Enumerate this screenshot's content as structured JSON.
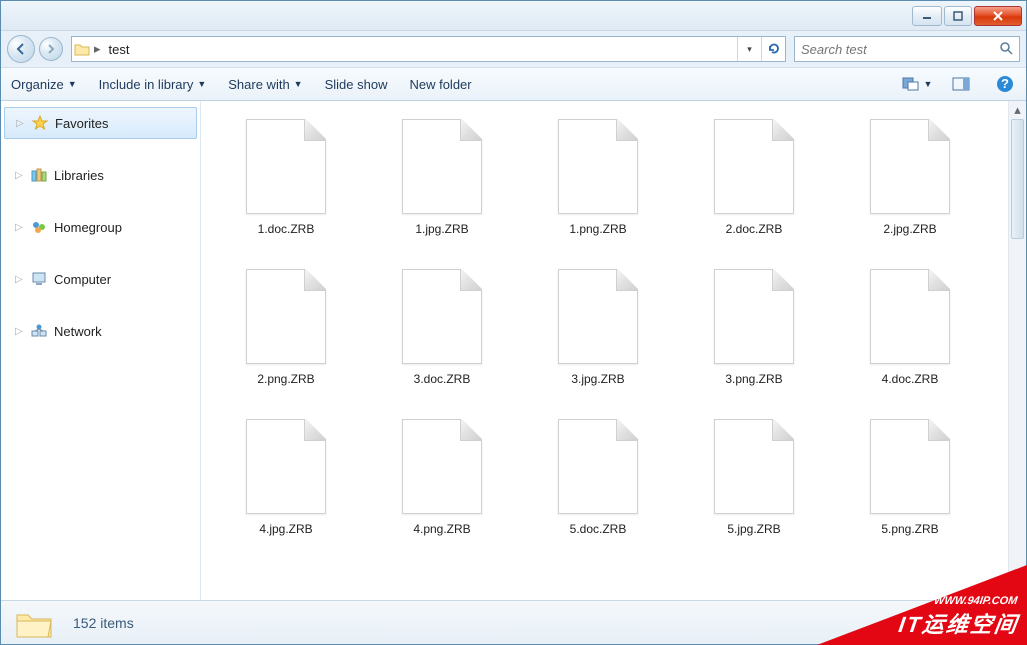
{
  "breadcrumb": {
    "folder": "test"
  },
  "search": {
    "placeholder": "Search test"
  },
  "toolbar": {
    "organize": "Organize",
    "include": "Include in library",
    "share": "Share with",
    "slideshow": "Slide show",
    "newfolder": "New folder"
  },
  "sidebar": {
    "items": [
      {
        "label": "Favorites"
      },
      {
        "label": "Libraries"
      },
      {
        "label": "Homegroup"
      },
      {
        "label": "Computer"
      },
      {
        "label": "Network"
      }
    ]
  },
  "files": [
    {
      "name": "1.doc.ZRB"
    },
    {
      "name": "1.jpg.ZRB"
    },
    {
      "name": "1.png.ZRB"
    },
    {
      "name": "2.doc.ZRB"
    },
    {
      "name": "2.jpg.ZRB"
    },
    {
      "name": "2.png.ZRB"
    },
    {
      "name": "3.doc.ZRB"
    },
    {
      "name": "3.jpg.ZRB"
    },
    {
      "name": "3.png.ZRB"
    },
    {
      "name": "4.doc.ZRB"
    },
    {
      "name": "4.jpg.ZRB"
    },
    {
      "name": "4.png.ZRB"
    },
    {
      "name": "5.doc.ZRB"
    },
    {
      "name": "5.jpg.ZRB"
    },
    {
      "name": "5.png.ZRB"
    }
  ],
  "status": {
    "count_label": "152 items"
  },
  "watermark": {
    "line1": "WWW.94IP.COM",
    "line2": "IT运维空间"
  }
}
